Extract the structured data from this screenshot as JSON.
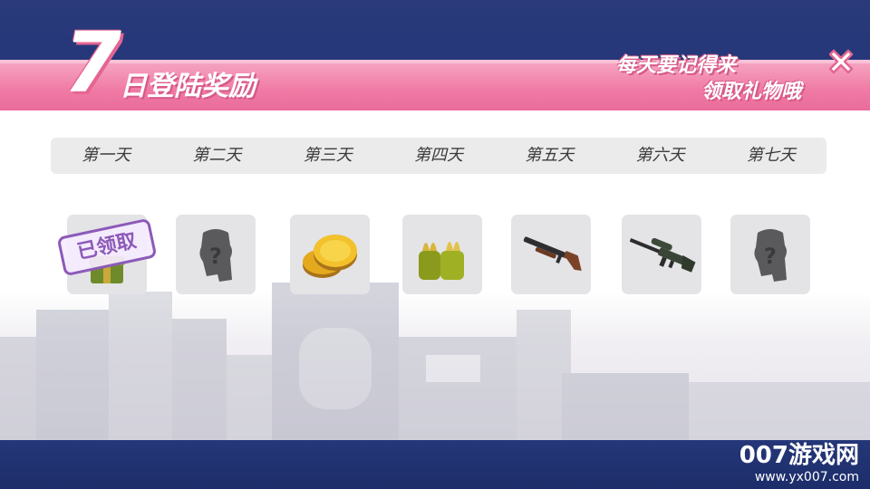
{
  "title": {
    "number": "7",
    "text": "日登陆奖励"
  },
  "subtitle": {
    "line1": "每天要记得来",
    "line2": "领取礼物哦"
  },
  "days": [
    {
      "label": "第一天",
      "reward_icon": "gift-icon",
      "claimed": true
    },
    {
      "label": "第二天",
      "reward_icon": "mystery-silhouette-icon",
      "claimed": false
    },
    {
      "label": "第三天",
      "reward_icon": "gold-coins-icon",
      "claimed": false
    },
    {
      "label": "第四天",
      "reward_icon": "ammo-bullets-icon",
      "claimed": false
    },
    {
      "label": "第五天",
      "reward_icon": "shotgun-icon",
      "claimed": false
    },
    {
      "label": "第六天",
      "reward_icon": "sniper-rifle-icon",
      "claimed": false
    },
    {
      "label": "第七天",
      "reward_icon": "mystery-silhouette-icon",
      "claimed": false
    }
  ],
  "claimed_stamp": "已领取",
  "watermark": {
    "brand": "007游戏网",
    "url": "www.yx007.com"
  },
  "colors": {
    "header_pink": "#f07aa5",
    "stamp_purple": "#8c5ab8",
    "frame_navy": "#253779"
  }
}
